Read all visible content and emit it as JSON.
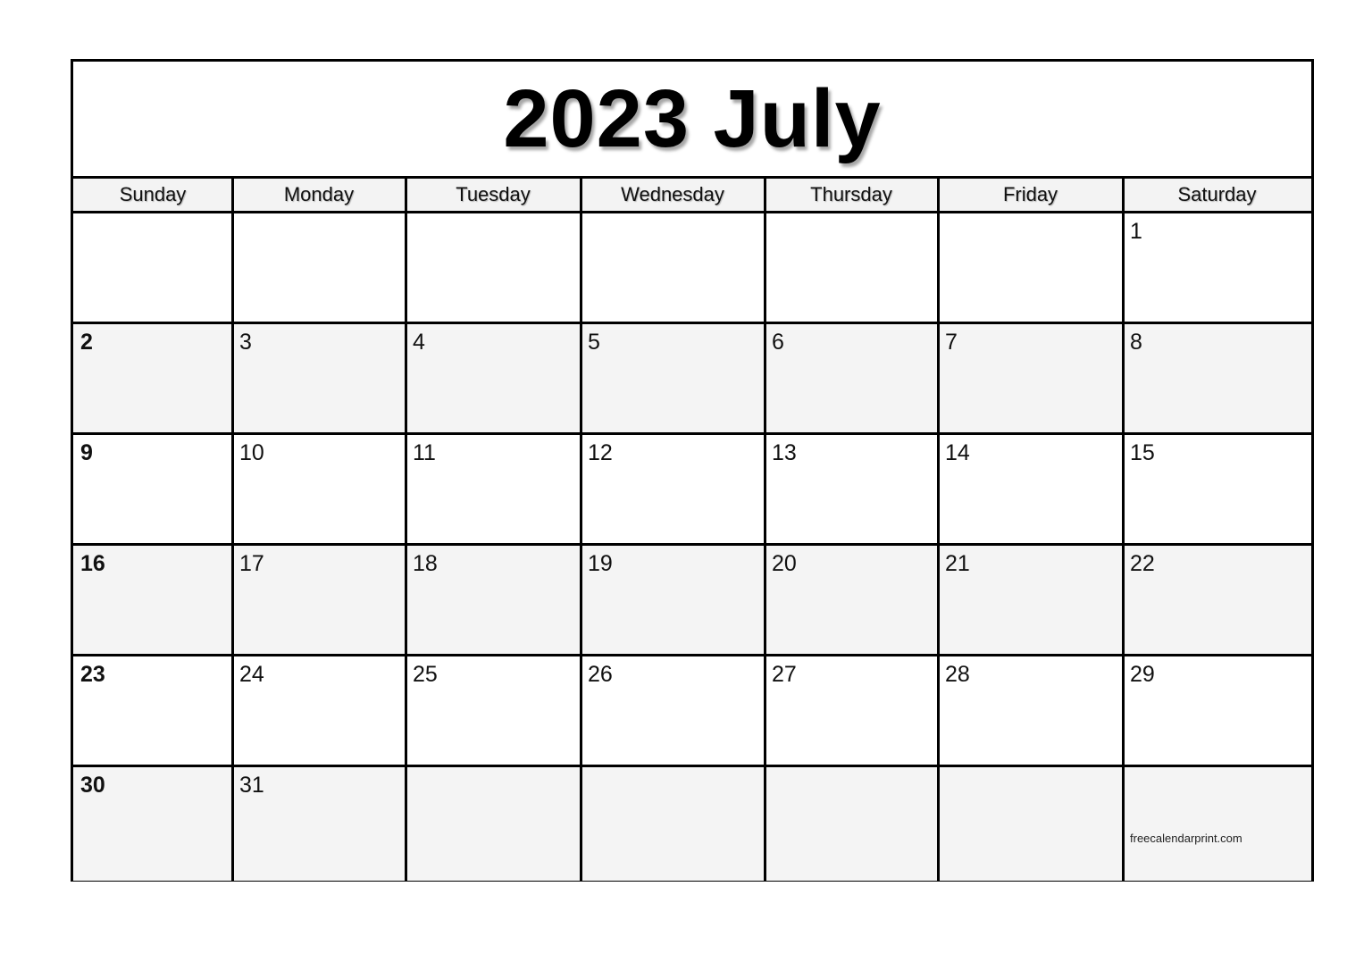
{
  "calendar": {
    "title": "2023 July",
    "weekdays": [
      "Sunday",
      "Monday",
      "Tuesday",
      "Wednesday",
      "Thursday",
      "Friday",
      "Saturday"
    ],
    "weeks": [
      [
        "",
        "",
        "",
        "",
        "",
        "",
        "1"
      ],
      [
        "2",
        "3",
        "4",
        "5",
        "6",
        "7",
        "8"
      ],
      [
        "9",
        "10",
        "11",
        "12",
        "13",
        "14",
        "15"
      ],
      [
        "16",
        "17",
        "18",
        "19",
        "20",
        "21",
        "22"
      ],
      [
        "23",
        "24",
        "25",
        "26",
        "27",
        "28",
        "29"
      ],
      [
        "30",
        "31",
        "",
        "",
        "",
        "",
        ""
      ]
    ],
    "credit": "freecalendarprint.com",
    "colors": {
      "border": "#000000",
      "shade": "#f4f4f4",
      "header_bg": "#f3f3f3"
    }
  }
}
